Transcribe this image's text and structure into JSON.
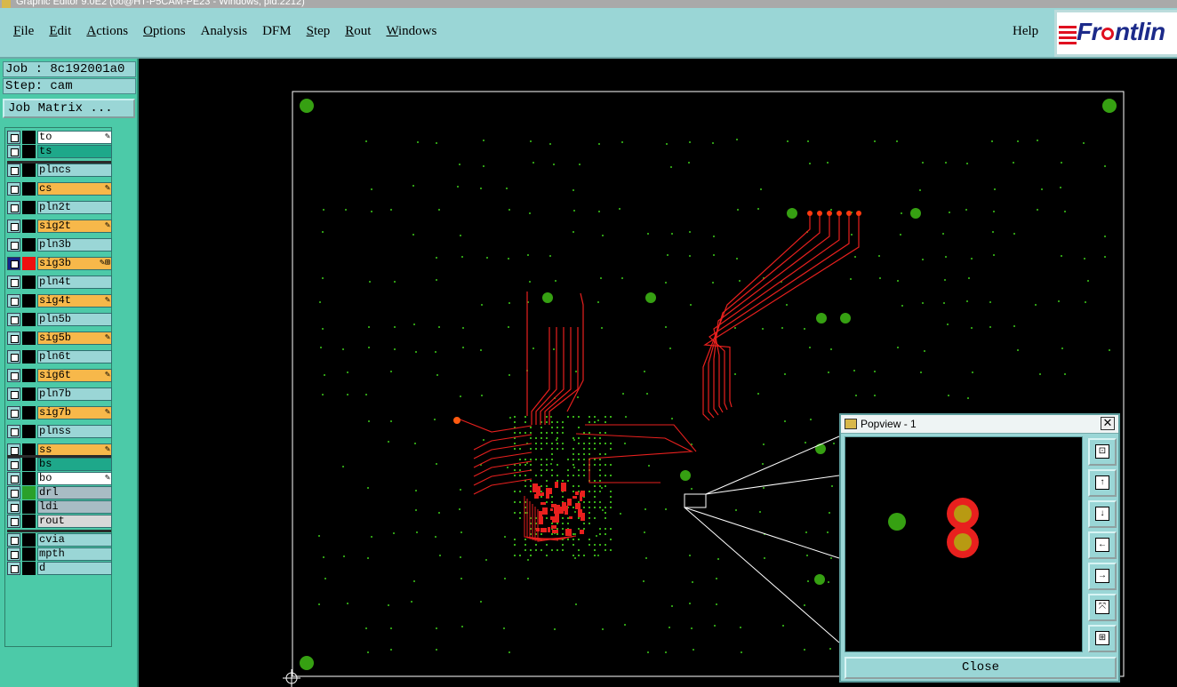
{
  "window": {
    "title": "Graphic Editor 9.0E2 (oo@HT-P5CAM-PE23 - Windows, pid:2212)"
  },
  "menubar": {
    "items": [
      {
        "label": "File",
        "u": "F",
        "rest": "ile"
      },
      {
        "label": "Edit",
        "u": "E",
        "rest": "dit"
      },
      {
        "label": "Actions",
        "u": "A",
        "rest": "ctions"
      },
      {
        "label": "Options",
        "u": "O",
        "rest": "ptions"
      },
      {
        "label": "Analysis",
        "u": "",
        "rest": "Analysis"
      },
      {
        "label": "DFM",
        "u": "",
        "rest": "DFM"
      },
      {
        "label": "Step",
        "u": "S",
        "rest": "tep"
      },
      {
        "label": "Rout",
        "u": "R",
        "rest": "out"
      },
      {
        "label": "Windows",
        "u": "W",
        "rest": "indows"
      }
    ],
    "help": "Help",
    "logo": {
      "pre": "Fr",
      "post": "ntlin",
      "brand": "Frontline"
    }
  },
  "panel": {
    "job": "Job : 8c192001a0",
    "step": "Step: cam",
    "job_matrix": "Job Matrix ..."
  },
  "layers": [
    {
      "name": "to",
      "bg": "#ffffff",
      "mark": "✎"
    },
    {
      "name": "ts",
      "bg": "#1ea88a",
      "mark": ""
    },
    {
      "name": "plncs",
      "bg": "#9ad6d6",
      "mark": ""
    },
    {
      "name": "cs",
      "bg": "#f7b84a",
      "mark": "✎"
    },
    {
      "name": "pln2t",
      "bg": "#9ad6d6",
      "mark": ""
    },
    {
      "name": "sig2t",
      "bg": "#f7b84a",
      "mark": "✎"
    },
    {
      "name": "pln3b",
      "bg": "#9ad6d6",
      "mark": ""
    },
    {
      "name": "sig3b",
      "bg": "#f7b84a",
      "mark": "✎⊞",
      "active": true,
      "swatch": "#ee1010"
    },
    {
      "name": "pln4t",
      "bg": "#9ad6d6",
      "mark": ""
    },
    {
      "name": "sig4t",
      "bg": "#f7b84a",
      "mark": "✎"
    },
    {
      "name": "pln5b",
      "bg": "#9ad6d6",
      "mark": ""
    },
    {
      "name": "sig5b",
      "bg": "#f7b84a",
      "mark": "✎"
    },
    {
      "name": "pln6t",
      "bg": "#9ad6d6",
      "mark": ""
    },
    {
      "name": "sig6t",
      "bg": "#f7b84a",
      "mark": "✎"
    },
    {
      "name": "pln7b",
      "bg": "#9ad6d6",
      "mark": ""
    },
    {
      "name": "sig7b",
      "bg": "#f7b84a",
      "mark": "✎"
    },
    {
      "name": "plnss",
      "bg": "#9ad6d6",
      "mark": ""
    },
    {
      "name": "ss",
      "bg": "#f7b84a",
      "mark": "✎"
    },
    {
      "name": "bs",
      "bg": "#1ea88a",
      "mark": ""
    },
    {
      "name": "bo",
      "bg": "#ffffff",
      "mark": "✎"
    },
    {
      "name": "drl",
      "bg": "#a8bcc4",
      "mark": "",
      "swatch": "#2aa02a"
    },
    {
      "name": "ldi",
      "bg": "#a8bcc4",
      "mark": ""
    },
    {
      "name": "rout",
      "bg": "#d8d8d8",
      "mark": ""
    },
    {
      "name": "cvia",
      "bg": "#9ad6d6",
      "mark": ""
    },
    {
      "name": "mpth",
      "bg": "#9ad6d6",
      "mark": ""
    },
    {
      "name": "d",
      "bg": "#9ad6d6",
      "mark": ""
    }
  ],
  "popview": {
    "title": "Popview - 1",
    "close_x": "✕",
    "close_label": "Close",
    "tools": [
      "zoom-fit",
      "pan-up",
      "pan-down",
      "pan-left",
      "pan-right",
      "zoom-out",
      "zoom-in"
    ]
  },
  "colors": {
    "trace": "#e8201e",
    "pad": "#36a012",
    "menubar": "#9ad6d6",
    "panel": "#4ccaa8"
  }
}
